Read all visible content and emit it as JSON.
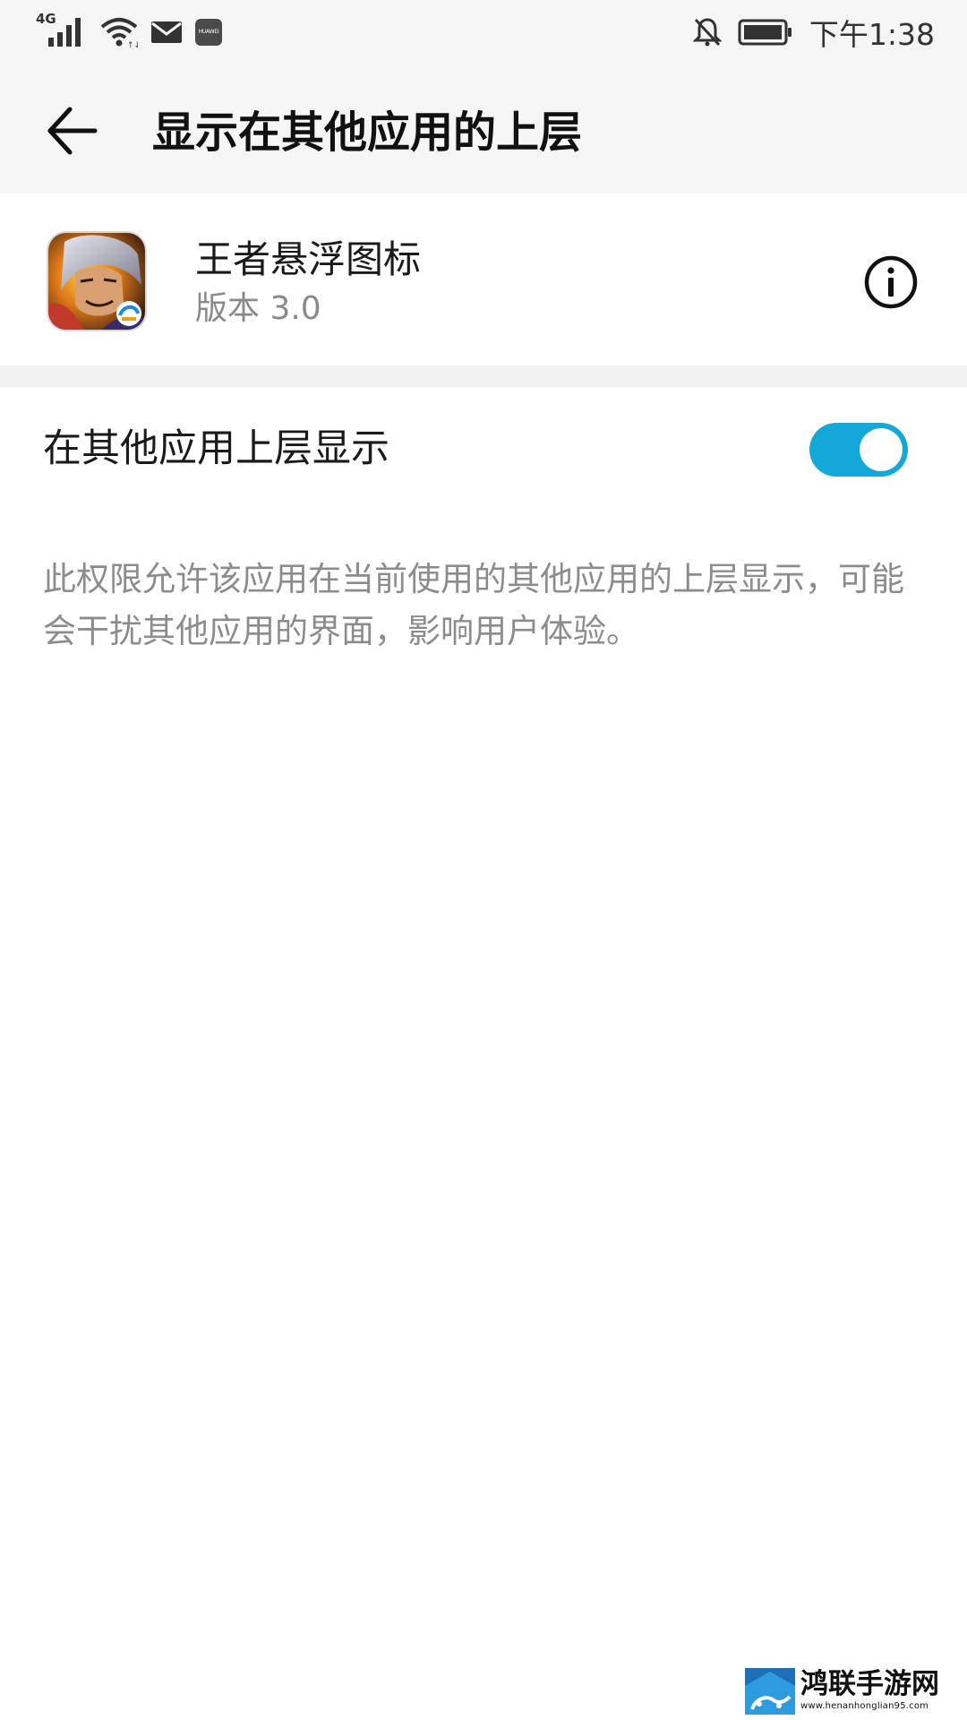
{
  "status_bar": {
    "network_type": "4G",
    "huawei_badge": "HUAWEI",
    "time": "下午1:38",
    "icons": [
      "signal-icon",
      "wifi-icon",
      "mail-icon",
      "huawei-app-icon",
      "notifications-off-icon",
      "battery-icon"
    ]
  },
  "header": {
    "title": "显示在其他应用的上层",
    "back_icon": "arrow-left-icon"
  },
  "app": {
    "name": "王者悬浮图标",
    "version": "版本 3.0",
    "info_icon": "info-icon"
  },
  "setting": {
    "label": "在其他应用上层显示",
    "enabled": true,
    "description": "此权限允许该应用在当前使用的其他应用的上层显示，可能会干扰其他应用的界面，影响用户体验。"
  },
  "watermark": {
    "name": "鸿联手游网",
    "url": "www.henanhonglian95.com"
  },
  "colors": {
    "toggle_on": "#13a8d8",
    "header_bg": "#f5f5f5",
    "secondary_text": "#8c8c8c"
  }
}
